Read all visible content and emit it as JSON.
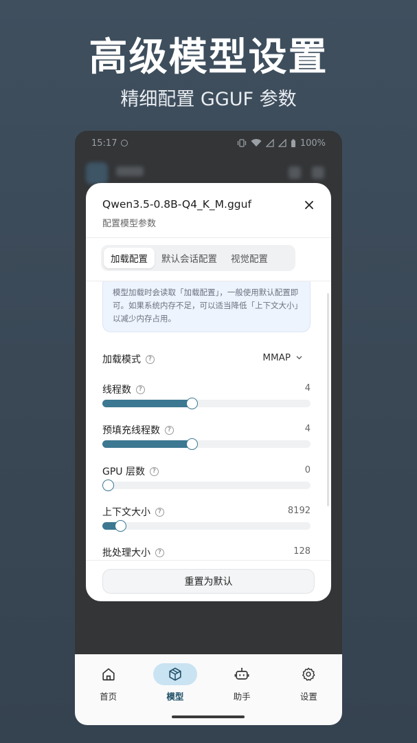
{
  "banner": {
    "title": "高级模型设置",
    "subtitle": "精细配置 GGUF 参数"
  },
  "status_bar": {
    "time": "15:17",
    "battery": "100%"
  },
  "dialog": {
    "title": "Qwen3.5-0.8B-Q4_K_M.gguf",
    "subtitle": "配置模型参数",
    "tabs": [
      {
        "label": "加载配置",
        "active": true
      },
      {
        "label": "默认会话配置",
        "active": false
      },
      {
        "label": "视觉配置",
        "active": false
      }
    ],
    "info_text": "模型加载时会读取「加载配置」，一般使用默认配置即可。如果系统内存不足，可以适当降低「上下文大小」以减少内存占用。",
    "load_mode": {
      "label": "加载模式",
      "value": "MMAP"
    },
    "sliders": [
      {
        "label": "线程数",
        "value": "4",
        "fraction": 0.43
      },
      {
        "label": "预填充线程数",
        "value": "4",
        "fraction": 0.43
      },
      {
        "label": "GPU 层数",
        "value": "0",
        "fraction": 0.0
      },
      {
        "label": "上下文大小",
        "value": "8192",
        "fraction": 0.085
      },
      {
        "label": "批处理大小",
        "value": "128"
      }
    ],
    "reset_label": "重置为默认"
  },
  "bottom_nav": [
    {
      "label": "首页",
      "icon": "home-icon",
      "active": false
    },
    {
      "label": "模型",
      "icon": "cube-icon",
      "active": true
    },
    {
      "label": "助手",
      "icon": "robot-icon",
      "active": false
    },
    {
      "label": "设置",
      "icon": "gear-icon",
      "active": false
    }
  ],
  "colors": {
    "accent": "#3c7891",
    "nav_active_bg": "#c9e3f2",
    "info_bg": "#eef4fd"
  }
}
